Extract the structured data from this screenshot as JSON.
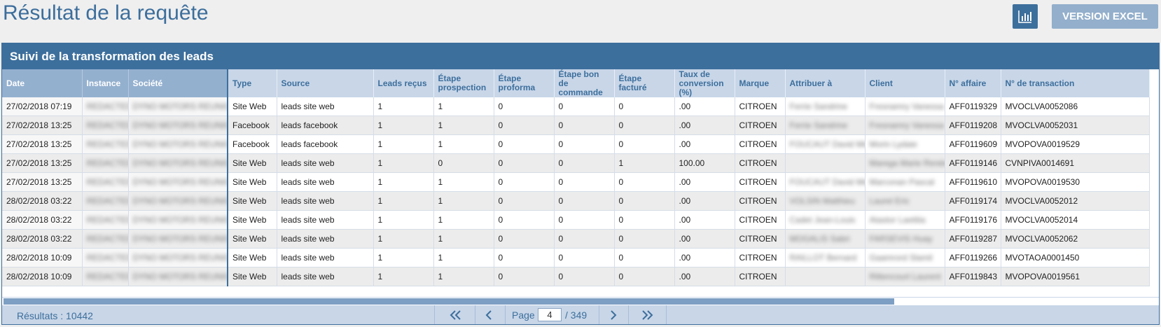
{
  "page": {
    "title": "Résultat de la requête",
    "excel_button": "VERSION EXCEL",
    "chart_button_icon": "bar-chart-icon"
  },
  "panel": {
    "title": "Suivi de la transformation des leads"
  },
  "columns": [
    "Date",
    "Instance",
    "Société",
    "Type",
    "Source",
    "Leads reçus",
    "Étape prospection",
    "Étape proforma",
    "Étape bon de commande",
    "Étape facturé",
    "Taux de conversion (%)",
    "Marque",
    "Attribuer à",
    "Client",
    "N° affaire",
    "N° de transaction"
  ],
  "rows": [
    [
      "27/02/2018 07:19",
      "REDACTED",
      "DYNO MOTORS REUNION",
      "Site Web",
      "leads site web",
      "1",
      "1",
      "0",
      "0",
      "0",
      ".00",
      "CITROEN",
      "Ferrie Sandrine",
      "Fresnamry Vanessa",
      "AFF0119329",
      "MVOCLVA0052086"
    ],
    [
      "27/02/2018 13:25",
      "REDACTED",
      "DYNO MOTORS REUNION",
      "Facebook",
      "leads facebook",
      "1",
      "1",
      "0",
      "0",
      "0",
      ".00",
      "CITROEN",
      "Ferrie Sandrine",
      "Fresnamry Vanessa",
      "AFF0119208",
      "MVOCLVA0052031"
    ],
    [
      "27/02/2018 13:25",
      "REDACTED",
      "DYNO MOTORS REUNION",
      "Facebook",
      "leads facebook",
      "1",
      "1",
      "0",
      "0",
      "0",
      ".00",
      "CITROEN",
      "FOUCAUT David Mich",
      "Morin Lydaie",
      "AFF0119609",
      "MVOPOVA0019529"
    ],
    [
      "27/02/2018 13:25",
      "REDACTED",
      "DYNO MOTORS REUNION",
      "Site Web",
      "leads site web",
      "1",
      "0",
      "0",
      "0",
      "1",
      "100.00",
      "CITROEN",
      "",
      "Marega Marie Renée",
      "AFF0119146",
      "CVNPIVA0014691"
    ],
    [
      "27/02/2018 13:25",
      "REDACTED",
      "DYNO MOTORS REUNION",
      "Site Web",
      "leads site web",
      "1",
      "1",
      "0",
      "0",
      "0",
      ".00",
      "CITROEN",
      "FOUCAUT David Mich",
      "Marconan Pascal",
      "AFF0119610",
      "MVOPOVA0019530"
    ],
    [
      "28/02/2018 03:22",
      "REDACTED",
      "DYNO MOTORS REUNION",
      "Site Web",
      "leads site web",
      "1",
      "1",
      "0",
      "0",
      "0",
      ".00",
      "CITROEN",
      "VOLSIN Matthieu",
      "Laurel Eric",
      "AFF0119174",
      "MVOCLVA0052012"
    ],
    [
      "28/02/2018 03:22",
      "REDACTED",
      "DYNO MOTORS REUNION",
      "Site Web",
      "leads site web",
      "1",
      "1",
      "0",
      "0",
      "0",
      ".00",
      "CITROEN",
      "Cadet Jean-Louis",
      "Atastor Laetitia",
      "AFF0119176",
      "MVOCLVA0052014"
    ],
    [
      "28/02/2018 03:22",
      "REDACTED",
      "DYNO MOTORS REUNION",
      "Site Web",
      "leads site web",
      "1",
      "1",
      "0",
      "0",
      "0",
      ".00",
      "CITROEN",
      "MOGALIS Sabri",
      "FARSEVIS Huay",
      "AFF0119287",
      "MVOCLVA0052062"
    ],
    [
      "28/02/2018 10:09",
      "REDACTED",
      "DYNO MOTORS REUNION",
      "Site Web",
      "leads site web",
      "1",
      "1",
      "0",
      "0",
      "0",
      ".00",
      "CITROEN",
      "RAILLOT Bernard",
      "Gaamrord Slamil",
      "AFF0119266",
      "MVOTAOA0001450"
    ],
    [
      "28/02/2018 10:09",
      "REDACTED",
      "DYNO MOTORS REUNION",
      "Site Web",
      "leads site web",
      "1",
      "1",
      "0",
      "0",
      "0",
      ".00",
      "CITROEN",
      "",
      "Rittencourt Laurent",
      "AFF0119843",
      "MVOPOVA0019561"
    ]
  ],
  "blurred_columns": [
    1,
    2,
    12,
    13
  ],
  "footer": {
    "results_label": "Résultats : 10442",
    "page_label": "Page",
    "page_value": "4",
    "page_total": "/ 349"
  }
}
